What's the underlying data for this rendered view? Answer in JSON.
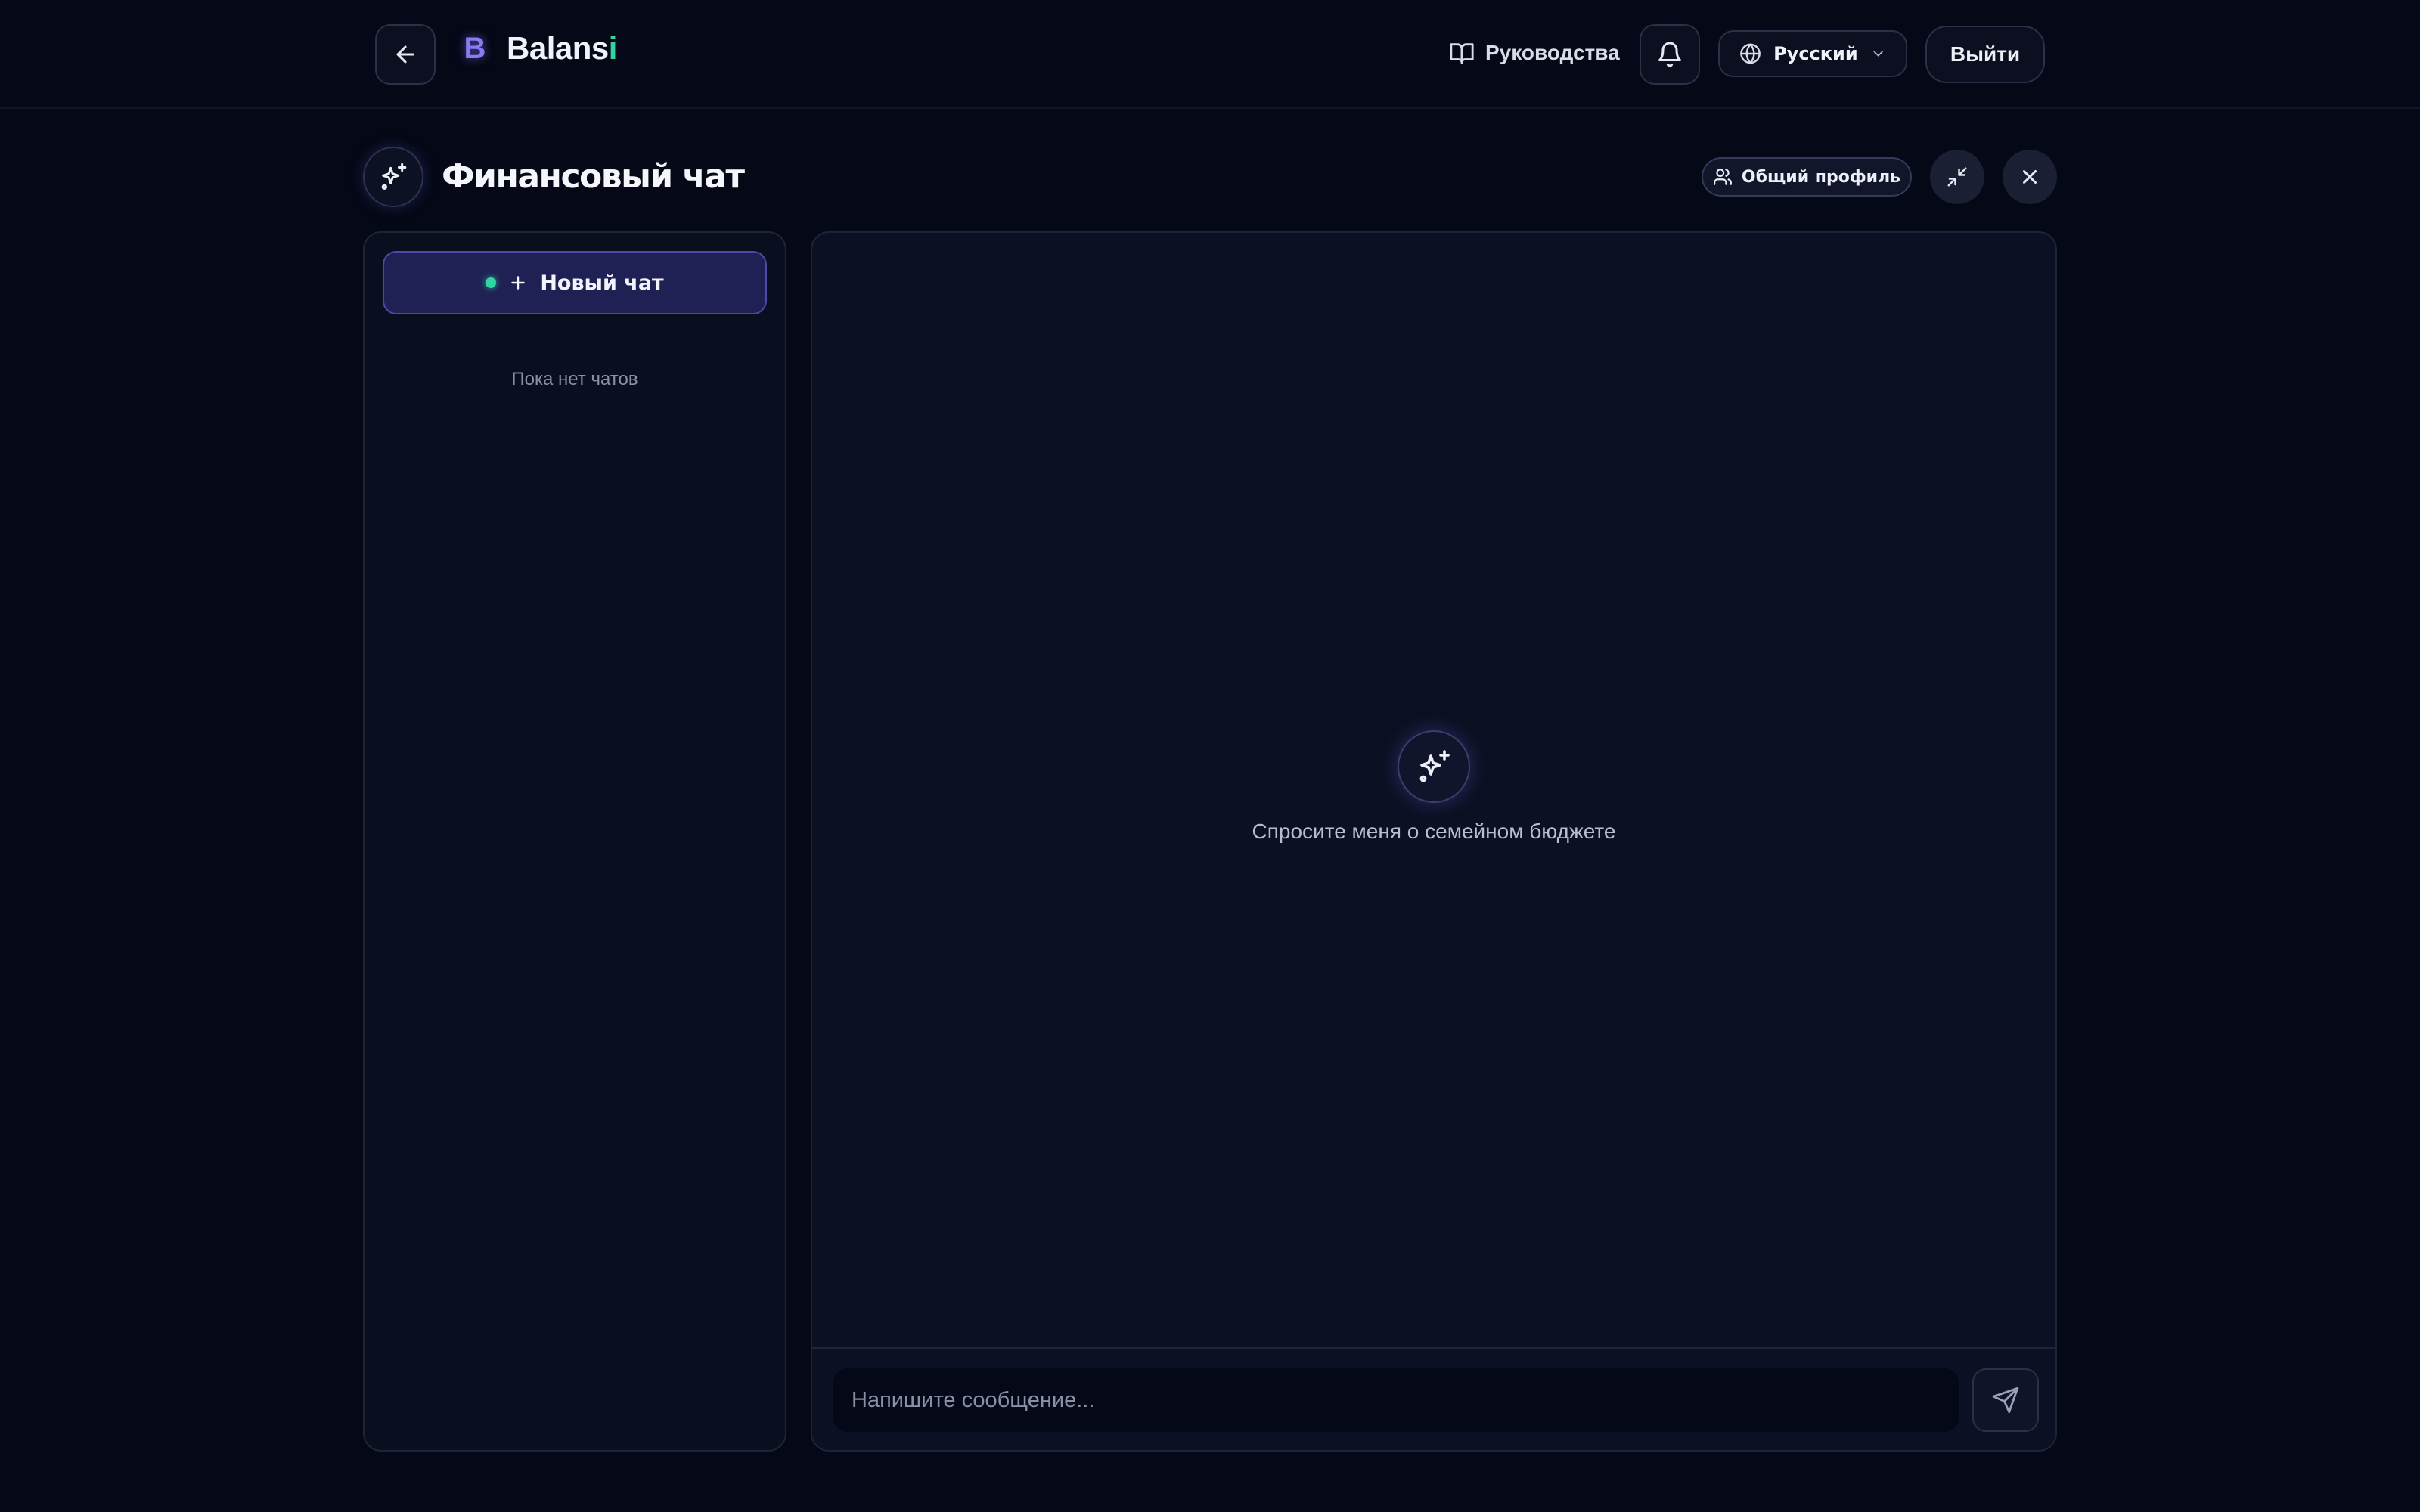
{
  "header": {
    "back_icon": "arrow-left-icon",
    "logo": {
      "mark": "B",
      "name_main": "Balans",
      "name_accent": "i",
      "accent_color": "#2fd6a0"
    },
    "guides_label": "Руководства",
    "guides_icon": "book-open-icon",
    "notifications_icon": "bell-icon",
    "language": {
      "icon": "globe-icon",
      "selected": "Русский"
    },
    "logout_label": "Выйти"
  },
  "chat_header": {
    "icon": "sparkles-icon",
    "title": "Финансовый чат",
    "profile_button": {
      "icon": "users-icon",
      "label": "Общий профиль"
    },
    "minimize_icon": "minimize-icon",
    "close_icon": "close-icon"
  },
  "sidebar": {
    "new_chat_label": "Новый чат",
    "status_color": "#2fd6a0",
    "empty_text": "Пока нет чатов"
  },
  "main": {
    "empty_icon": "sparkles-icon",
    "empty_text": "Спросите меня о семейном бюджете",
    "input_placeholder": "Напишите сообщение...",
    "send_icon": "send-icon"
  },
  "colors": {
    "background": "#050816",
    "brand": "#4c4aa6",
    "accent": "#2fd6a0"
  }
}
